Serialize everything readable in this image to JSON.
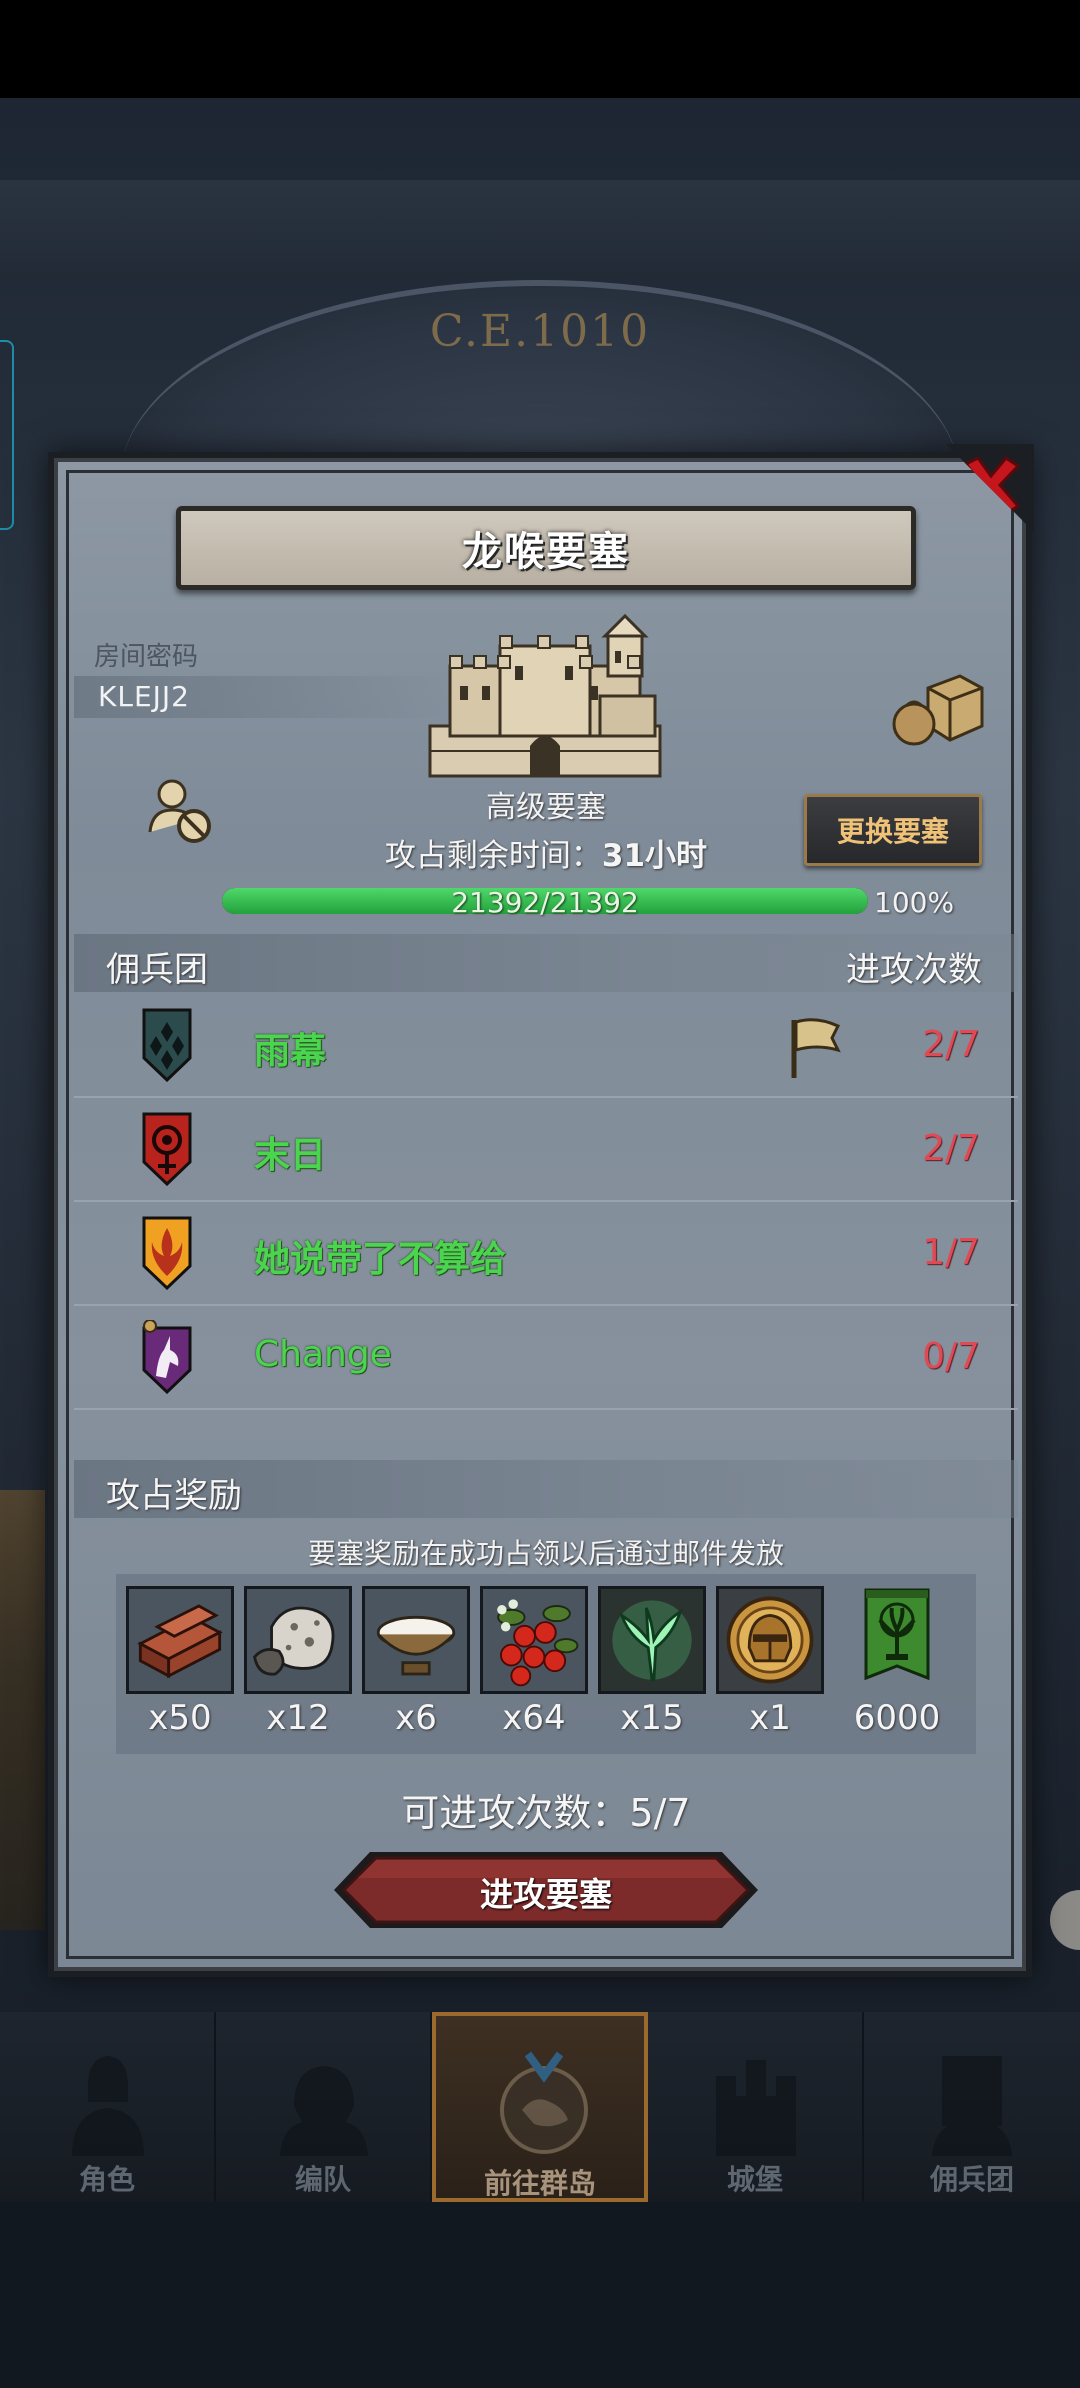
{
  "background": {
    "calendar_label": "C.E.1010"
  },
  "panel": {
    "title": "龙喉要塞",
    "room_label": "房间密码",
    "room_code": "KLEJJ2",
    "fortress_level": "高级要塞",
    "change_button": "更换要塞",
    "remaining_label": "攻占剩余时间：",
    "remaining_value": "31小时",
    "hp_text": "21392/21392",
    "hp_percent_text": "100%",
    "hp_fraction": 1.0
  },
  "mercenary_section": {
    "left_header": "佣兵团",
    "right_header": "进攻次数",
    "rows": [
      {
        "name": "雨幕",
        "count": "2/7",
        "icon": "diamond-shield-icon",
        "flag": true
      },
      {
        "name": "末日",
        "count": "2/7",
        "icon": "red-eye-shield-icon",
        "flag": false
      },
      {
        "name": "她说带了不算给",
        "count": "1/7",
        "icon": "flame-shield-icon",
        "flag": false
      },
      {
        "name": "Change",
        "count": "0/7",
        "icon": "unicorn-shield-icon",
        "flag": false
      }
    ]
  },
  "reward_section": {
    "header": "攻占奖励",
    "note": "要塞奖励在成功占领以后通过邮件发放",
    "items": [
      {
        "icon": "wood-planks-icon",
        "qty": "x50"
      },
      {
        "icon": "ore-chunk-icon",
        "qty": "x12"
      },
      {
        "icon": "milk-bowl-icon",
        "qty": "x6"
      },
      {
        "icon": "berries-icon",
        "qty": "x64"
      },
      {
        "icon": "green-spirit-tree-icon",
        "qty": "x15"
      },
      {
        "icon": "golden-helmet-coin-icon",
        "qty": "x1"
      },
      {
        "icon": "tree-banner-icon",
        "qty": "6000"
      }
    ]
  },
  "attacks_left": "可进攻次数：5/7",
  "attack_button": "进攻要塞",
  "nav": [
    {
      "label": "角色"
    },
    {
      "label": "编队"
    },
    {
      "label": "前往群岛"
    },
    {
      "label": "城堡"
    },
    {
      "label": "佣兵团"
    }
  ]
}
